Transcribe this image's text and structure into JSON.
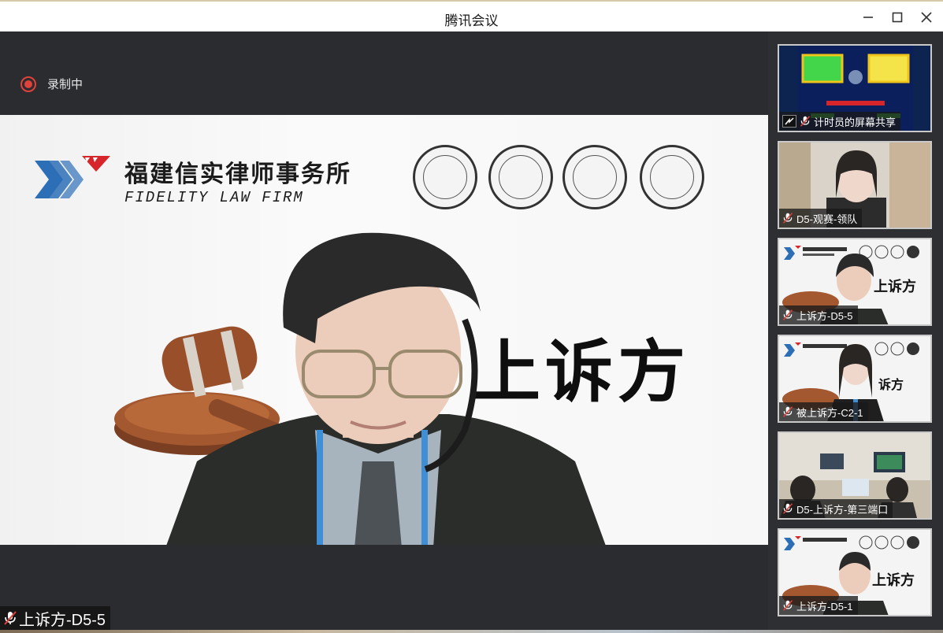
{
  "window": {
    "title": "腾讯会议",
    "minimize_icon": "minimize-icon",
    "maximize_icon": "maximize-icon",
    "close_icon": "close-icon"
  },
  "recording": {
    "label": "录制中",
    "color": "#e0413a"
  },
  "main_video": {
    "firm_name_cn": "福建信实律师事务所",
    "firm_name_en": "FIDELITY LAW FIRM",
    "side_label": "上诉方",
    "speaker_name": "上诉方-D5-5",
    "logo_colors": [
      "#2d6fb6",
      "#d7262b"
    ]
  },
  "participants": [
    {
      "name": "计时员的屏幕共享",
      "type": "screen-share",
      "muted": true
    },
    {
      "name": "D5-观赛-领队",
      "type": "camera",
      "muted": true
    },
    {
      "name": "上诉方-D5-5",
      "type": "camera",
      "muted": true,
      "side_label": "上诉方"
    },
    {
      "name": "被上诉方-C2-1",
      "type": "camera",
      "muted": true,
      "side_label": "诉方"
    },
    {
      "name": "D5-上诉方-第三端口",
      "type": "camera",
      "muted": true
    },
    {
      "name": "上诉方-D5-1",
      "type": "camera",
      "muted": true,
      "side_label": "上诉方"
    }
  ],
  "theme": {
    "stage_bg": "#2a2c2f",
    "sidebar_bg": "#2d2f33",
    "accent_red": "#e0413a"
  }
}
